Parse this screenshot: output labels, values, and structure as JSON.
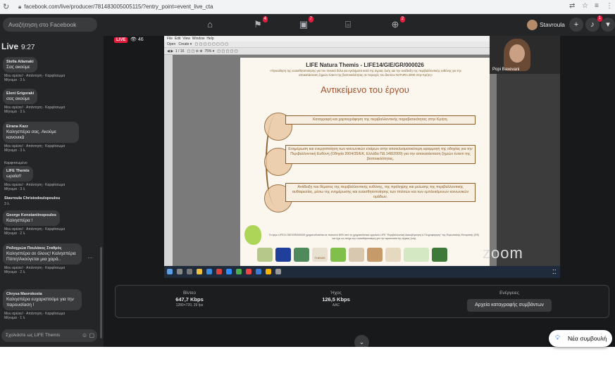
{
  "browser": {
    "url": "facebook.com/live/producer/781483005005115/?entry_point=event_live_cta"
  },
  "fb": {
    "search_placeholder": "Αναζήτηση στο Facebook",
    "badges": {
      "flag": "4",
      "games": "7",
      "groups": "2"
    },
    "user_name": "Stavroula",
    "notif_count": "1"
  },
  "chat": {
    "live_label": "Live",
    "time": "9:27",
    "actions": "Μου αρέσει! · Απάντηση · Καρφίτσωμα",
    "messages": [
      {
        "name": "Stella Ailamaki",
        "text": "Σας ακούμε",
        "meta": "Μήνυμα · 3 λ."
      },
      {
        "name": "Eleni Grigoraki",
        "text": "σας ακούμε",
        "meta": "Μήνυμα · 3 λ."
      },
      {
        "name": "Eirana Kazz",
        "text": "Καλησπέρα σας. Ακούμε κανονικά",
        "meta": "Μήνυμα · 3 λ."
      },
      {
        "name": "LIFE Themis",
        "text": "ωραία!!",
        "meta": "Μήνυμα · 3 λ.",
        "pinned": "Καρφιτσωμένο"
      },
      {
        "name": "Stavroula Christodoulopoulou",
        "text": "",
        "meta": "3 λ."
      },
      {
        "name": "George Konstantinopoulos",
        "text": "Καλησπέρα !",
        "meta": "Μήνυμα · 2 λ."
      },
      {
        "name": "Ροδοχρώα Πουλάκος Σταθμός",
        "text": "Καλησπέρα σε όλους! Καλησπέρα Πόπη!Ακούγεται μια χαρά..",
        "meta": "Μήνυμα · 2 λ."
      },
      {
        "name": "Chrysa Mavrokosta",
        "text": "Καλησπέρα ευχαριστούμε για την παρουσίαση !",
        "meta": "Μήνυμα · 1 λ."
      }
    ],
    "input_placeholder": "Σχολιάστε ως LIFE Themis"
  },
  "stage": {
    "live_badge": "LIVE",
    "viewers": "46"
  },
  "slide": {
    "toolbar_open": "Open",
    "toolbar_create": "Create",
    "zoom": "75%",
    "title": "LIFE Natura Themis - LIFE14/GIE/GR/000026",
    "subtitle": "«Προώθηση της ευαισθητοποίησης για τον ποινικό δόλο για εγκλήματα κατά της άγριας ζωής και την ανάδειξη της περιβαλλοντικής ευθύνης για την αποκατάσταση ζημιών έναντι της βιοποικιλότητας σε περιοχές του δικτύου NATURA 2000 στην Κρήτη»",
    "heading": "Αντικείμενο του έργου",
    "items": [
      "Καταγραφή και χαρτογράφηση της περιβαλλοντικής παραβατικότητας στην Κρήτη.",
      "Ενημέρωση και ενεργοποίηση των κοινωνικών εταίρων στην αποτελεσματικότερη εφαρμογή της οδηγίας για την Περιβαλλοντική Ευθύνη (Οδηγία 2004/35/ΕΚ, Ελλάδα ΠΔ 148/2009) για την αποκατάσταση ζημιών έναντι της βιοποικιλότητας.",
      "Ανάδειξη του θέματος της περιβαλλοντικής ευθύνης, της πρόληψης και μείωσης της περιβαλλοντικής αυθαιρεσίας, μέσω της ενημέρωσης και ευαισθητοποίησης των πολιτών και των εμπλεκόμενων κοινωνικών ομάδων."
    ],
    "footer": "Το έργο LIFE14 GIE/GR/000026 χρηματοδοτείται σε ποσοστό 60% από το χρηματοδοτικό εργαλείο LIFE \"Περιβαλλοντική Διακυβέρνηση & Πληροφόρηση\" της Ευρωπαϊκής Επιτροπής (ΕΕ) και έχει ως στόχο την ευαισθητοποίηση για την προστασία της άγριας ζωής",
    "logo_themis": "THEMIS",
    "participant_name": "Popi Baxevani",
    "zoom_watermark": "zoom"
  },
  "stats": {
    "video_label": "Βίντεο",
    "video_value": "647,7 Kbps",
    "video_sub": "1280×720, 29 fps",
    "audio_label": "Ήχος",
    "audio_value": "126,5 Kbps",
    "audio_sub": "AAC",
    "actions_label": "Ενέργειες",
    "recording_button": "Αρχεία καταγραφής συμβάντων"
  },
  "new_message_button": "Νέα συμβουλή",
  "colors": {
    "accent": "#1877f2",
    "live": "#e41e3f",
    "slide_brown": "#8b5e2b"
  }
}
